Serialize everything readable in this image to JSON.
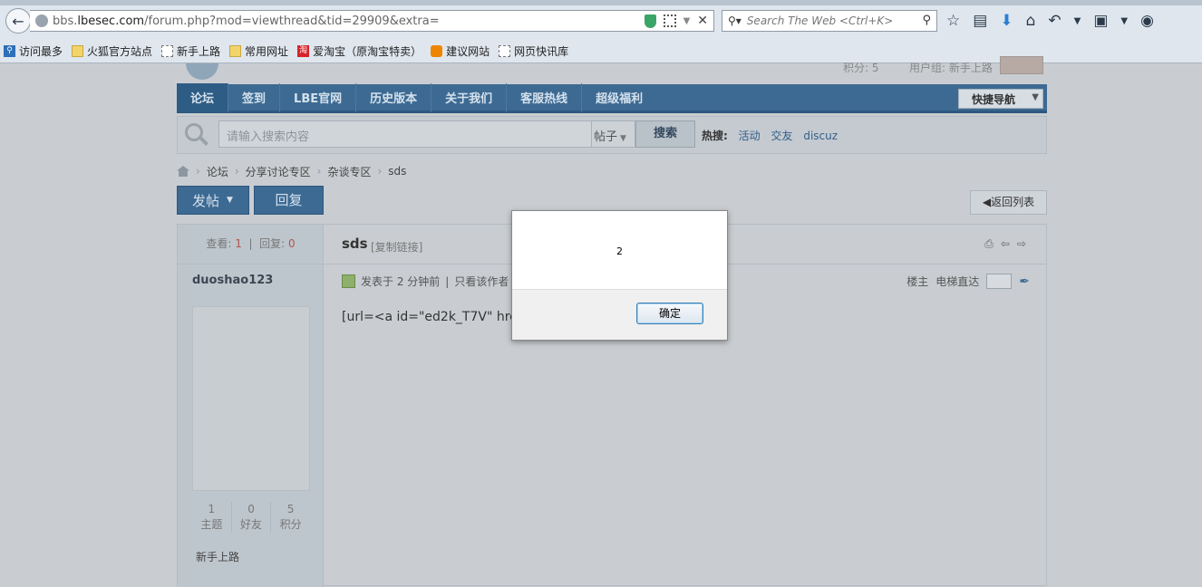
{
  "browser": {
    "url_prefix": "bbs.",
    "url_domain": "lbesec.com",
    "url_path": "/forum.php?mod=viewthread&tid=29909&extra=",
    "search_placeholder": "Search The Web <Ctrl+K>",
    "bookmarks": [
      {
        "label": "访问最多",
        "icon": "most-visited-icon"
      },
      {
        "label": "火狐官方站点",
        "icon": "folder-icon"
      },
      {
        "label": "新手上路",
        "icon": "page-icon"
      },
      {
        "label": "常用网址",
        "icon": "folder-icon"
      },
      {
        "label": "爱淘宝（原淘宝特卖）",
        "icon": "taobao-icon"
      },
      {
        "label": "建议网站",
        "icon": "suggest-icon"
      },
      {
        "label": "网页快讯库",
        "icon": "page-icon"
      }
    ]
  },
  "header": {
    "points": "积分: 5",
    "usergroup": "用户组: 新手上路"
  },
  "nav": {
    "items": [
      "论坛",
      "签到",
      "LBE官网",
      "历史版本",
      "关于我们",
      "客服热线",
      "超级福利"
    ],
    "quick_nav": "快捷导航"
  },
  "search": {
    "placeholder": "请输入搜索内容",
    "type": "帖子",
    "button": "搜索",
    "hot_label": "热搜:",
    "hot_terms": [
      "活动",
      "交友",
      "discuz"
    ]
  },
  "breadcrumb": [
    "论坛",
    "分享讨论专区",
    "杂谈专区",
    "sds"
  ],
  "actions": {
    "post": "发帖",
    "reply": "回复",
    "back_list": "返回列表"
  },
  "thread": {
    "views_label": "查看:",
    "views": "1",
    "replies_label": "回复:",
    "replies": "0",
    "title": "sds",
    "copy_link": "[复制链接]",
    "author": "duoshao123",
    "counts": [
      {
        "value": "1",
        "label": "主题"
      },
      {
        "value": "0",
        "label": "好友"
      },
      {
        "value": "5",
        "label": "积分"
      }
    ],
    "rank": "新手上路",
    "posted": "发表于 2 分钟前",
    "only_author": "只看该作者",
    "floor": "楼主",
    "elevator": "电梯直达",
    "body": "[url=<a id=\"ed2k_T7V\" href=\""
  },
  "dialog": {
    "message": "2",
    "ok": "确定"
  }
}
